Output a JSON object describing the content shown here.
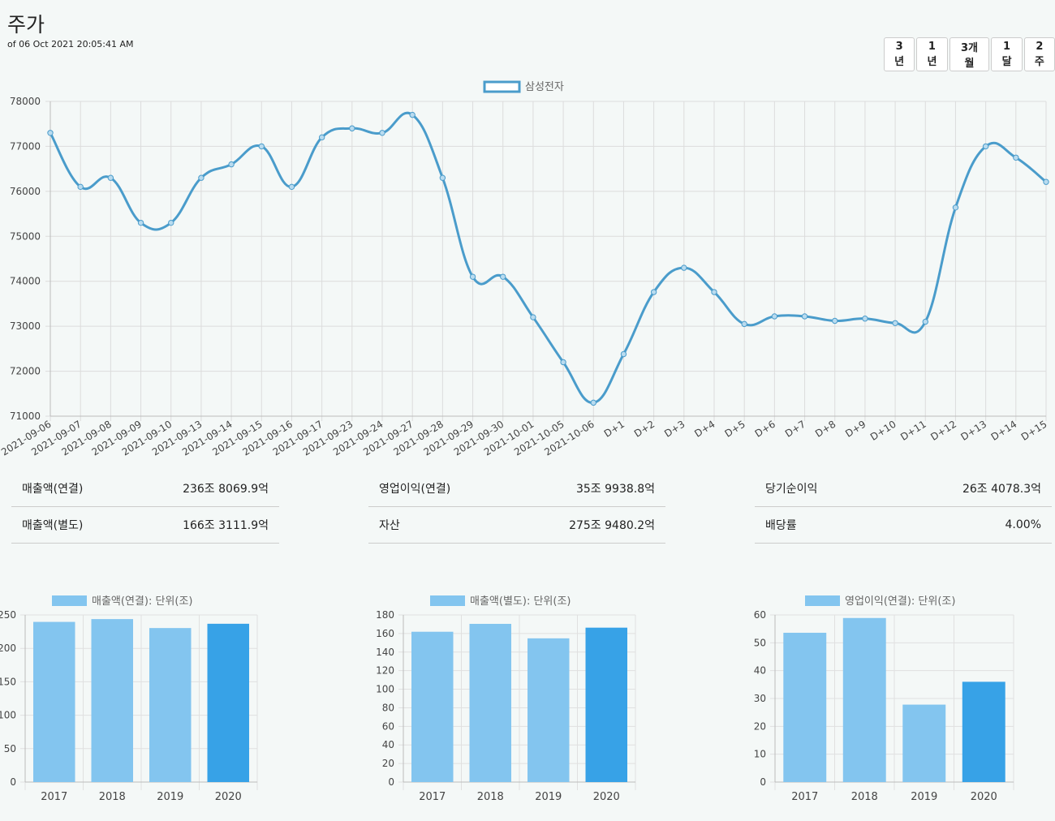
{
  "header": {
    "title": "주가",
    "as_of": "of 06 Oct 2021 20:05:41 AM"
  },
  "range_buttons": [
    "3년",
    "1년",
    "3개월",
    "1달",
    "2주"
  ],
  "chart_data": [
    {
      "type": "line",
      "legend": "삼성전자",
      "series": [
        {
          "name": "삼성전자",
          "color": "#4a9ccb",
          "values": [
            77300,
            76100,
            76300,
            75300,
            75300,
            76300,
            76600,
            77000,
            76100,
            77200,
            77400,
            77300,
            77700,
            76300,
            74100,
            74100,
            73200,
            72200,
            71300,
            72380,
            73760,
            74300,
            73760,
            73050,
            73220,
            73220,
            73120,
            73170,
            73070,
            73100,
            75640,
            77000,
            76750,
            76210
          ]
        }
      ],
      "categories": [
        "2021-09-06",
        "2021-09-07",
        "2021-09-08",
        "2021-09-09",
        "2021-09-10",
        "2021-09-13",
        "2021-09-14",
        "2021-09-15",
        "2021-09-16",
        "2021-09-17",
        "2021-09-23",
        "2021-09-24",
        "2021-09-27",
        "2021-09-28",
        "2021-09-29",
        "2021-09-30",
        "2021-10-01",
        "2021-10-05",
        "2021-10-06",
        "D+1",
        "D+2",
        "D+3",
        "D+4",
        "D+5",
        "D+6",
        "D+7",
        "D+8",
        "D+9",
        "D+10",
        "D+11",
        "D+12",
        "D+13",
        "D+14",
        "D+15"
      ],
      "yticks": [
        71000,
        72000,
        73000,
        74000,
        75000,
        76000,
        77000,
        78000
      ],
      "ylim": [
        71000,
        78000
      ],
      "grid": true,
      "legend_position": "top-center"
    },
    {
      "type": "bar",
      "legend": "매출액(연결): 단위(조)",
      "categories": [
        "2017",
        "2018",
        "2019",
        "2020"
      ],
      "values": [
        239.6,
        243.8,
        230.4,
        236.8
      ],
      "yticks": [
        0,
        50,
        100,
        150,
        200,
        250
      ],
      "ylim": [
        0,
        250
      ],
      "colors": [
        "#83c5ef",
        "#83c5ef",
        "#83c5ef",
        "#37a2e7"
      ]
    },
    {
      "type": "bar",
      "legend": "매출액(별도): 단위(조)",
      "categories": [
        "2017",
        "2018",
        "2019",
        "2020"
      ],
      "values": [
        161.9,
        170.4,
        154.8,
        166.3
      ],
      "yticks": [
        0,
        20,
        40,
        60,
        80,
        100,
        120,
        140,
        160,
        180
      ],
      "ylim": [
        0,
        180
      ],
      "colors": [
        "#83c5ef",
        "#83c5ef",
        "#83c5ef",
        "#37a2e7"
      ]
    },
    {
      "type": "bar",
      "legend": "영업이익(연결): 단위(조)",
      "categories": [
        "2017",
        "2018",
        "2019",
        "2020"
      ],
      "values": [
        53.6,
        58.9,
        27.8,
        36.0
      ],
      "yticks": [
        0,
        10,
        20,
        30,
        40,
        50,
        60
      ],
      "ylim": [
        0,
        60
      ],
      "colors": [
        "#83c5ef",
        "#83c5ef",
        "#83c5ef",
        "#37a2e7"
      ]
    }
  ],
  "financials": [
    [
      {
        "label": "매출액(연결)",
        "value": "236조 8069.9억"
      },
      {
        "label": "매출액(별도)",
        "value": "166조 3111.9억"
      }
    ],
    [
      {
        "label": "영업이익(연결)",
        "value": "35조 9938.8억"
      },
      {
        "label": "자산",
        "value": "275조 9480.2억"
      }
    ],
    [
      {
        "label": "당기순이익",
        "value": "26조 4078.3억"
      },
      {
        "label": "배당률",
        "value": "4.00%"
      }
    ]
  ]
}
